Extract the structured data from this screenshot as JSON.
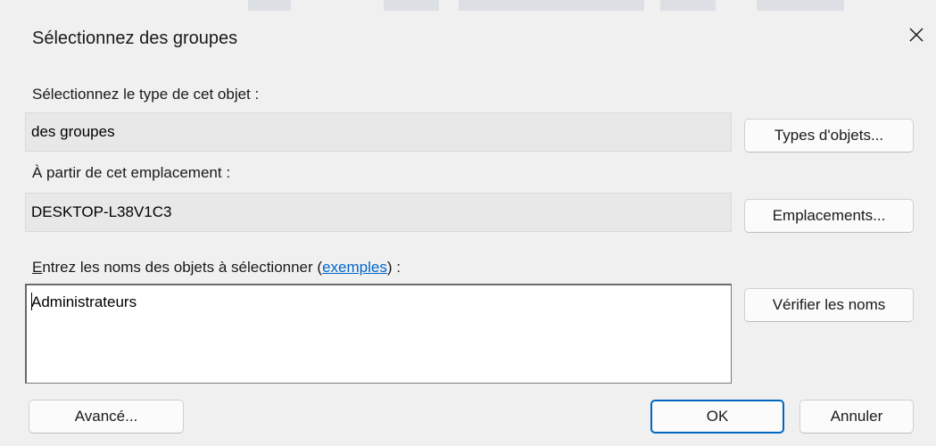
{
  "dialog": {
    "title": "Sélectionnez des groupes"
  },
  "object_type": {
    "label": "Sélectionnez le type de cet objet :",
    "value": "des groupes",
    "button": "Types d'objets..."
  },
  "location": {
    "label": "À partir de cet emplacement :",
    "value": "DESKTOP-L38V1C3",
    "button": "Emplacements..."
  },
  "names": {
    "label_prefix_accel": "E",
    "label_prefix_rest": "ntrez les noms des objets à sélectionner (",
    "label_link": "exemples",
    "label_suffix": ") :",
    "value": "Administrateurs",
    "check_button": "Vérifier les noms"
  },
  "footer": {
    "advanced_button": "Avancé...",
    "ok_button": "OK",
    "cancel_button": "Annuler"
  },
  "icons": {
    "close": "close-icon"
  },
  "colors": {
    "link": "#0066cc",
    "ok_border": "#0067c0"
  }
}
